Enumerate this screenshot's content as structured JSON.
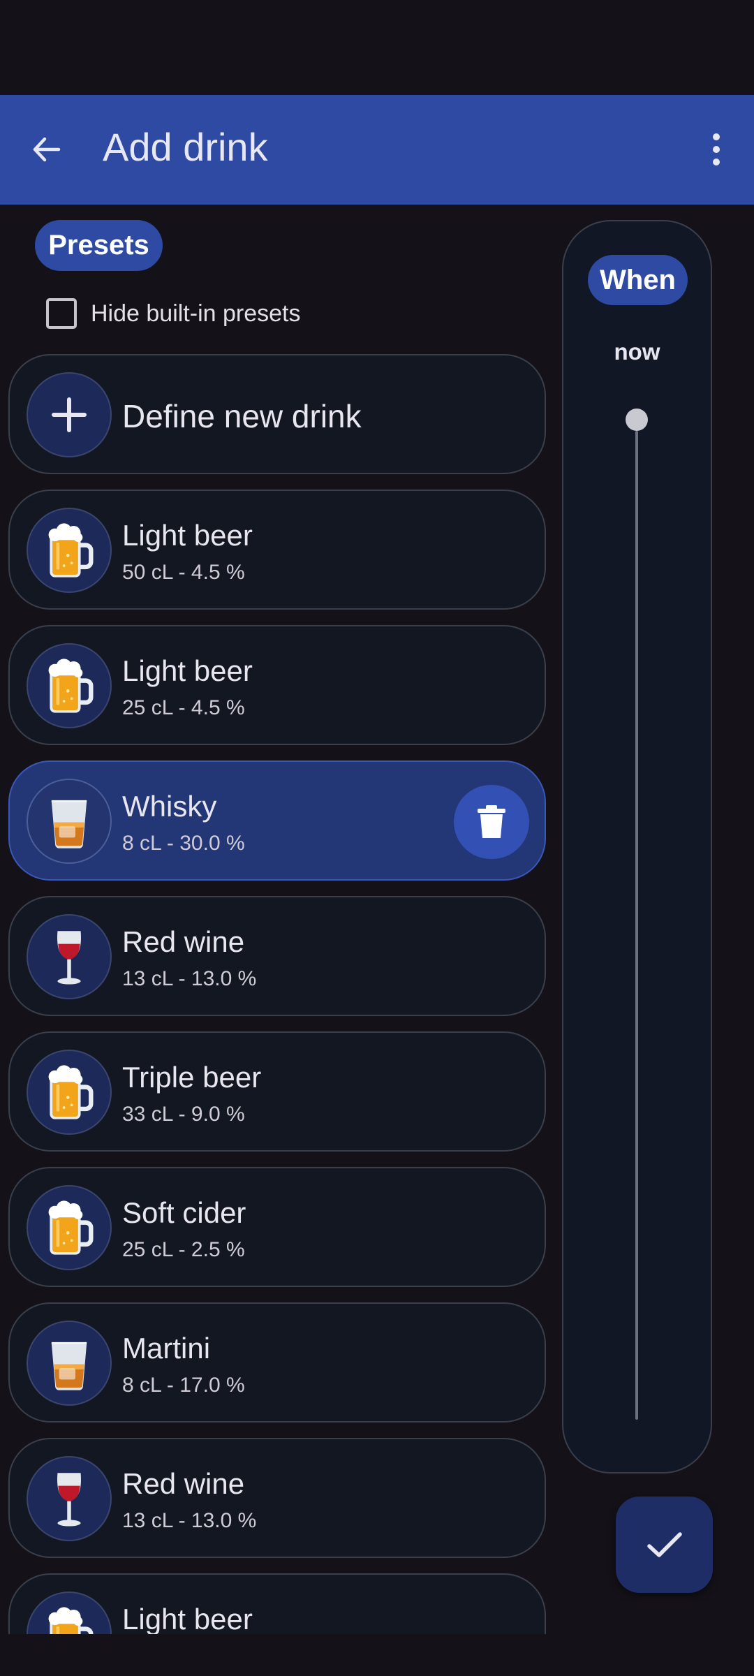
{
  "appbar": {
    "title": "Add drink",
    "back_icon": "arrow-left-icon",
    "more_icon": "more-vert-icon",
    "color": "#2f4aa3"
  },
  "presets": {
    "chip_label": "Presets",
    "hide_builtin_label": "Hide built-in presets",
    "hide_builtin_checked": false,
    "define_new_label": "Define new drink"
  },
  "drinks": [
    {
      "name": "Light beer",
      "detail": "50 cL - 4.5 %",
      "icon": "beer-mug-icon",
      "selected": false
    },
    {
      "name": "Light beer",
      "detail": "25 cL - 4.5 %",
      "icon": "beer-mug-icon",
      "selected": false
    },
    {
      "name": "Whisky",
      "detail": "8 cL - 30.0 %",
      "icon": "tumbler-glass-icon",
      "selected": true
    },
    {
      "name": "Red wine",
      "detail": "13 cL - 13.0 %",
      "icon": "wine-glass-icon",
      "selected": false
    },
    {
      "name": "Triple beer",
      "detail": "33 cL - 9.0 %",
      "icon": "beer-mug-icon",
      "selected": false
    },
    {
      "name": "Soft cider",
      "detail": "25 cL - 2.5 %",
      "icon": "beer-mug-icon",
      "selected": false
    },
    {
      "name": "Martini",
      "detail": "8 cL - 17.0 %",
      "icon": "tumbler-glass-icon",
      "selected": false
    },
    {
      "name": "Red wine",
      "detail": "13 cL - 13.0 %",
      "icon": "wine-glass-icon",
      "selected": false
    },
    {
      "name": "Light beer",
      "detail": "",
      "icon": "beer-mug-icon",
      "selected": false
    }
  ],
  "when": {
    "chip_label": "When",
    "value": "now",
    "slider_level": 0
  },
  "confirm_icon": "check-icon"
}
